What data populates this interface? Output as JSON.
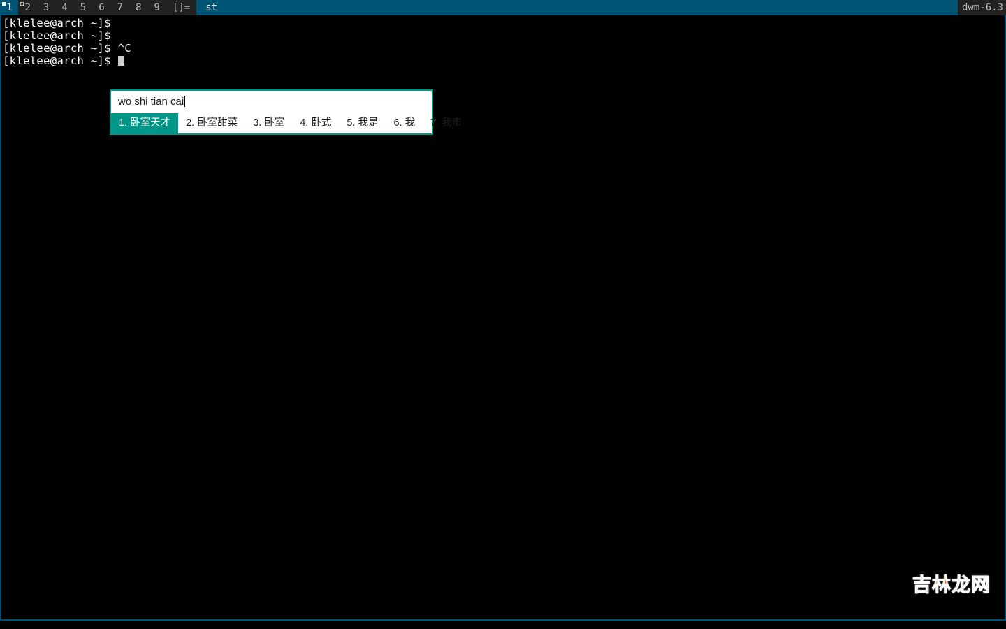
{
  "statusbar": {
    "tags": [
      {
        "label": "1",
        "selected": true,
        "indicator": "filled"
      },
      {
        "label": "2",
        "selected": false,
        "indicator": "hollow"
      },
      {
        "label": "3",
        "selected": false,
        "indicator": "none"
      },
      {
        "label": "4",
        "selected": false,
        "indicator": "none"
      },
      {
        "label": "5",
        "selected": false,
        "indicator": "none"
      },
      {
        "label": "6",
        "selected": false,
        "indicator": "none"
      },
      {
        "label": "7",
        "selected": false,
        "indicator": "none"
      },
      {
        "label": "8",
        "selected": false,
        "indicator": "none"
      },
      {
        "label": "9",
        "selected": false,
        "indicator": "none"
      }
    ],
    "layout_symbol": "[]=",
    "window_title": "st",
    "status_text": "dwm-6.3",
    "accent_blue": "#005577",
    "dark_bg": "#222222"
  },
  "terminal": {
    "lines": [
      "[klelee@arch ~]$",
      "[klelee@arch ~]$",
      "[klelee@arch ~]$ ^C",
      "[klelee@arch ~]$"
    ],
    "prompt": "[klelee@arch ~]$",
    "interrupt_text": "^C",
    "foreground": "#ffffff",
    "background": "#000000"
  },
  "ime": {
    "preedit": "wo shi tian cai",
    "accent_color": "#009688",
    "candidates": [
      {
        "index": "1.",
        "text": "卧室天才",
        "active": true
      },
      {
        "index": "2.",
        "text": "卧室甜菜",
        "active": false
      },
      {
        "index": "3.",
        "text": "卧室",
        "active": false
      },
      {
        "index": "4.",
        "text": "卧式",
        "active": false
      },
      {
        "index": "5.",
        "text": "我是",
        "active": false
      },
      {
        "index": "6.",
        "text": "我",
        "active": false
      },
      {
        "index": "7.",
        "text": "我市",
        "active": false
      }
    ]
  },
  "watermark": {
    "text": "吉林龙网",
    "color": "#f06a28"
  }
}
